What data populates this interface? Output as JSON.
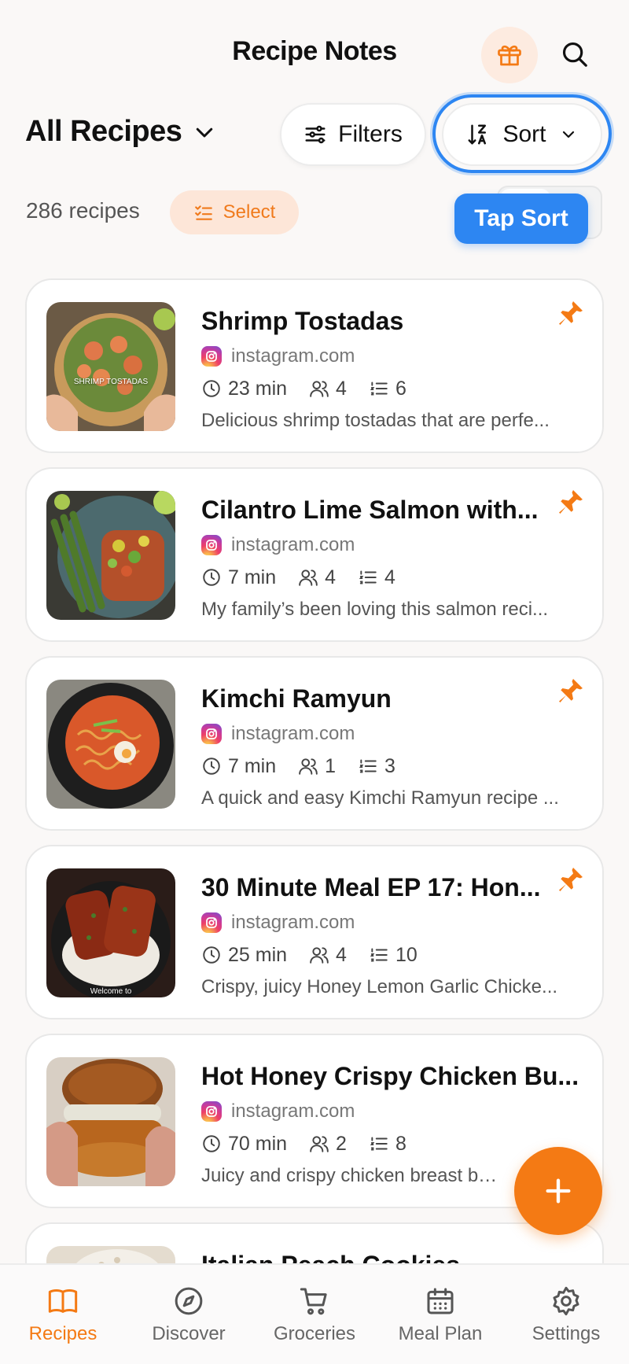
{
  "header": {
    "title": "Recipe Notes",
    "gift_icon": "gift-icon",
    "search_icon": "search-icon"
  },
  "toolbar": {
    "collection_label": "All Recipes",
    "filters_label": "Filters",
    "sort_label": "Sort",
    "count_text": "286 recipes",
    "select_label": "Select",
    "tooltip": "Tap Sort"
  },
  "colors": {
    "accent": "#f47a14",
    "highlight": "#2d86f2",
    "select_bg": "#fde6d8"
  },
  "recipes": [
    {
      "title": "Shrimp Tostadas",
      "source": "instagram.com",
      "time": "23 min",
      "servings": "4",
      "steps": "6",
      "description": "Delicious shrimp tostadas that are perfe...",
      "pinned": true,
      "thumb_caption": "SHRIMP TOSTADAS"
    },
    {
      "title": "Cilantro Lime Salmon with...",
      "source": "instagram.com",
      "time": "7 min",
      "servings": "4",
      "steps": "4",
      "description": "My family’s been loving this salmon reci...",
      "pinned": true,
      "thumb_caption": ""
    },
    {
      "title": "Kimchi Ramyun",
      "source": "instagram.com",
      "time": "7 min",
      "servings": "1",
      "steps": "3",
      "description": "A quick and easy Kimchi Ramyun recipe ...",
      "pinned": true,
      "thumb_caption": ""
    },
    {
      "title": "30 Minute Meal EP 17: Hon...",
      "source": "instagram.com",
      "time": "25 min",
      "servings": "4",
      "steps": "10",
      "description": "Crispy, juicy Honey Lemon Garlic Chicke...",
      "pinned": true,
      "thumb_caption": "Welcome to"
    },
    {
      "title": "Hot Honey Crispy Chicken Bu...",
      "source": "instagram.com",
      "time": "70 min",
      "servings": "2",
      "steps": "8",
      "description": "Juicy and crispy chicken breast bur...",
      "pinned": false,
      "thumb_caption": ""
    },
    {
      "title": "Italian Peach Cookies",
      "source": "",
      "time": "",
      "servings": "",
      "steps": "",
      "description": "",
      "pinned": false,
      "thumb_caption": ""
    }
  ],
  "tabs": [
    {
      "label": "Recipes",
      "icon": "book-icon",
      "active": true
    },
    {
      "label": "Discover",
      "icon": "compass-icon",
      "active": false
    },
    {
      "label": "Groceries",
      "icon": "cart-icon",
      "active": false
    },
    {
      "label": "Meal Plan",
      "icon": "calendar-icon",
      "active": false
    },
    {
      "label": "Settings",
      "icon": "gear-icon",
      "active": false
    }
  ]
}
